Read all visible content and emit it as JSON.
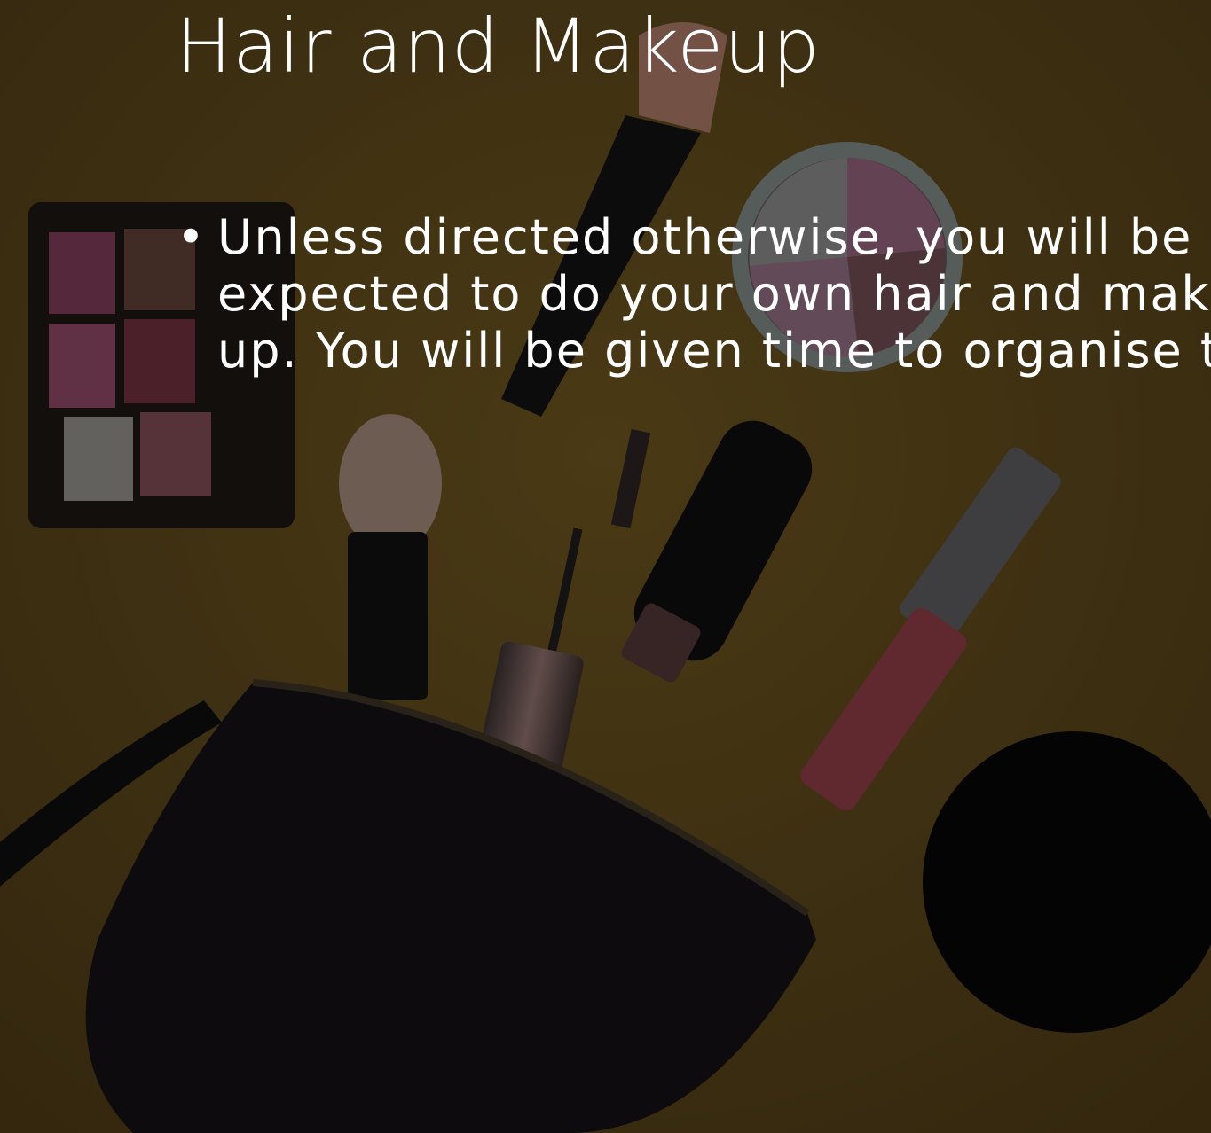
{
  "slide": {
    "title": "Hair and Makeup",
    "bullets": [
      {
        "marker": "•",
        "text": "Unless directed otherwise, you will be expected to do your own hair and make up. You will be given time to organise this."
      }
    ]
  },
  "background": {
    "image_subject": "makeup-flatlay",
    "colors": {
      "backdrop": "#574319",
      "overlay": "rgba(0,0,0,0.55)",
      "text": "#ffffff"
    }
  }
}
